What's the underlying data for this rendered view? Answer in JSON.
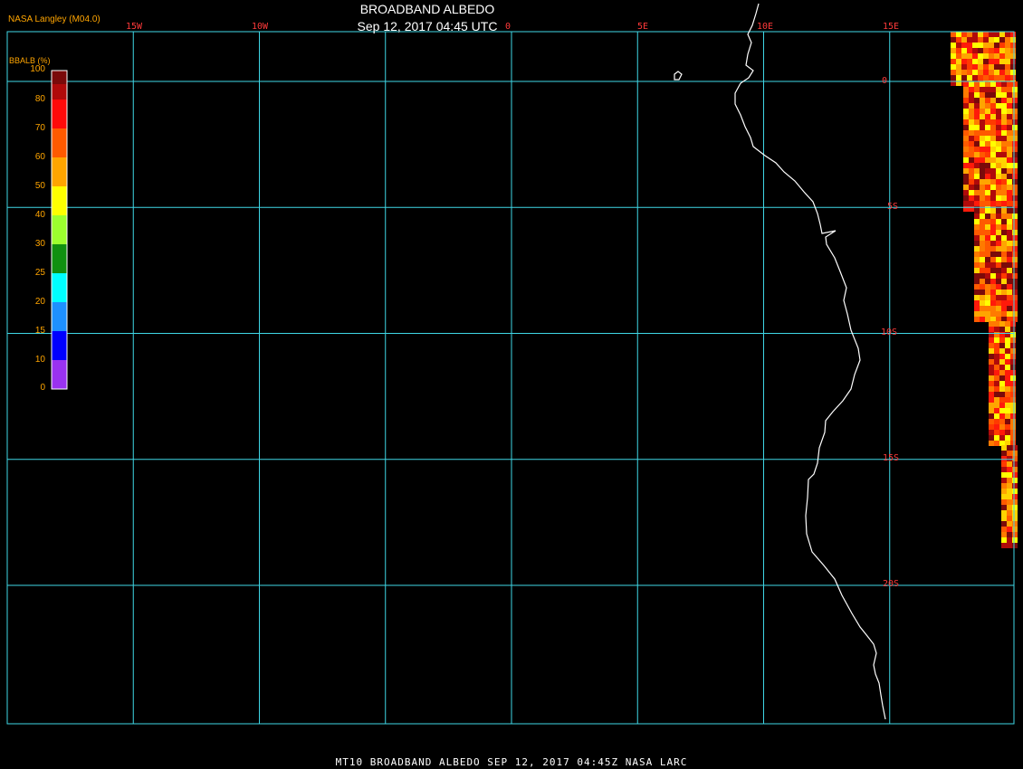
{
  "title": "BROADBAND ALBEDO",
  "subtitle": "Sep 12, 2017 04:45 UTC",
  "credit": "NASA Langley (M04.0)",
  "footer": "MT10  BROADBAND ALBEDO   SEP 12, 2017 04:45Z   NASA LARC",
  "map": {
    "projection": "lat-lon",
    "lon_range": [
      -20,
      20
    ],
    "lat_range": [
      2,
      -25
    ],
    "lon_gridlines": [
      -15,
      -10,
      -5,
      0,
      5,
      10,
      15
    ],
    "lat_gridlines": [
      0,
      -5,
      -10,
      -15,
      -20
    ],
    "lon_labels": [
      "15W",
      "10W",
      "",
      "0",
      "5E",
      "10E",
      "15E"
    ],
    "lat_labels": [
      "0",
      "5S",
      "10S",
      "15S",
      "20S"
    ],
    "grid_color": "#3fd7e6",
    "label_color": "#ff3a3a",
    "coast_color": "#ffffff"
  },
  "legend": {
    "title": "BBALB (%)",
    "colors": [
      "#7a0a0a",
      "#b00a0a",
      "#ff0a0a",
      "#ff5a00",
      "#ffa500",
      "#ffff00",
      "#9cff2e",
      "#109010",
      "#00ffff",
      "#1e90ff",
      "#0000ff",
      "#9a32f0"
    ],
    "labels": [
      "100",
      "80",
      "70",
      "60",
      "50",
      "40",
      "30",
      "25",
      "20",
      "15",
      "10",
      "0"
    ]
  },
  "swath_colors": [
    "#ff5a00",
    "#ff7a00",
    "#ff3a00",
    "#ffa500",
    "#ffd400",
    "#ff1a0a",
    "#b00a0a",
    "#7a0a0a",
    "#ffff00"
  ]
}
